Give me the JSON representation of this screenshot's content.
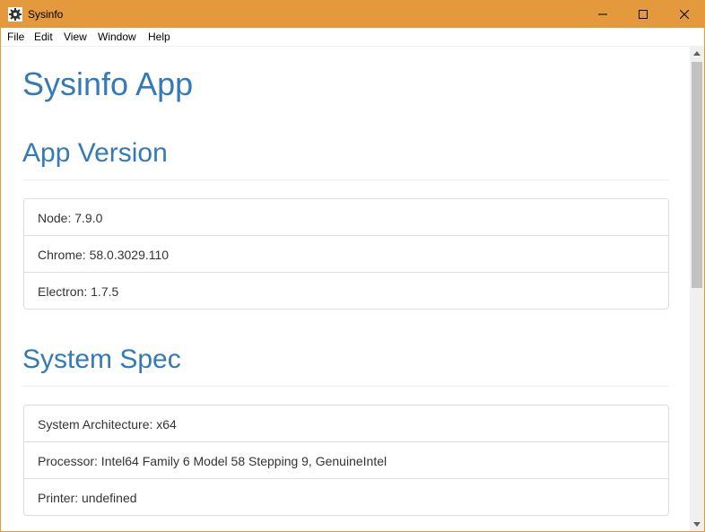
{
  "window": {
    "title": "Sysinfo",
    "accent_color": "#e3993c",
    "icons": {
      "app": "gear-icon",
      "minimize": "minimize-icon",
      "maximize": "maximize-icon",
      "close": "close-icon"
    }
  },
  "menu": {
    "items": [
      "File",
      "Edit",
      "View",
      "Window",
      "Help"
    ]
  },
  "page": {
    "title": "Sysinfo App",
    "heading_color": "#337ab7",
    "sections": [
      {
        "heading": "App Version",
        "items": [
          "Node: 7.9.0",
          "Chrome: 58.0.3029.110",
          "Electron: 1.7.5"
        ]
      },
      {
        "heading": "System Spec",
        "items": [
          "System Architecture: x64",
          "Processor: Intel64 Family 6 Model 58 Stepping 9, GenuineIntel",
          "Printer: undefined"
        ]
      }
    ]
  },
  "scrollbar": {
    "icons": {
      "up": "arrow-up-icon",
      "down": "arrow-down-icon"
    }
  }
}
